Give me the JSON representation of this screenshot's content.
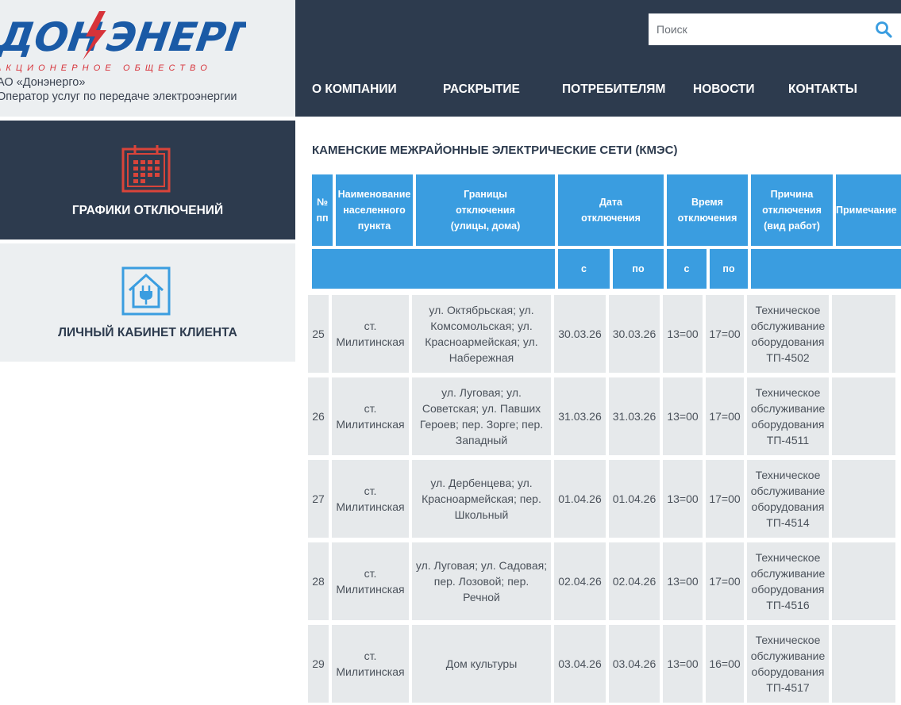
{
  "logo": {
    "wordmark": "ДОН ЭНЕРГО",
    "subtitle": "АКЦИОНЕРНОЕ ОБЩЕСТВО",
    "company": "АО «Донэнерго»",
    "tagline": "Оператор услуг по передаче электроэнергии"
  },
  "search": {
    "placeholder": "Поиск"
  },
  "nav": {
    "items": [
      {
        "label": "О КОМПАНИИ"
      },
      {
        "label": "РАСКРЫТИЕ"
      },
      {
        "label": "ПОТРЕБИТЕЛЯМ"
      },
      {
        "label": "НОВОСТИ"
      },
      {
        "label": "КОНТАКТЫ"
      }
    ]
  },
  "sidebar": {
    "outages": {
      "label": "ГРАФИКИ ОТКЛЮЧЕНИЙ",
      "icon": "calendar-icon",
      "color": "#d9443a"
    },
    "cabinet": {
      "label": "ЛИЧНЫЙ КАБИНЕТ КЛИЕНТА",
      "icon": "house-plug-icon",
      "color": "#3a9de0"
    }
  },
  "main": {
    "title": "КАМЕНСКИЕ МЕЖРАЙОННЫЕ ЭЛЕКТРИЧЕСКИЕ СЕТИ (КМЭС)"
  },
  "table": {
    "headers": {
      "num": "№\nпп",
      "place": "Наименование\nнаселенного\nпункта",
      "bounds": "Границы\nотключения\n(улицы, дома)",
      "date": "Дата\nотключения",
      "time": "Время\nотключения",
      "reason": "Причина\nотключения\n(вид работ)",
      "note": "Примечание",
      "date_from": "с",
      "date_to": "по",
      "time_from": "с",
      "time_to": "по"
    },
    "rows": [
      {
        "num": "25",
        "place": "ст. Милитинская",
        "bounds": "ул. Октябрьская; ул. Комсомольская; ул. Красноармейская; ул. Набережная",
        "date_from": "30.03.26",
        "date_to": "30.03.26",
        "time_from": "13=00",
        "time_to": "17=00",
        "reason": "Техническое обслуживание оборудования ТП-4502",
        "note": ""
      },
      {
        "num": "26",
        "place": "ст. Милитинская",
        "bounds": "ул. Луговая; ул. Советская; ул. Павших Героев; пер. Зорге; пер. Западный",
        "date_from": "31.03.26",
        "date_to": "31.03.26",
        "time_from": "13=00",
        "time_to": "17=00",
        "reason": "Техническое обслуживание оборудования ТП-4511",
        "note": ""
      },
      {
        "num": "27",
        "place": "ст. Милитинская",
        "bounds": "ул. Дербенцева; ул. Красноармейская; пер. Школьный",
        "date_from": "01.04.26",
        "date_to": "01.04.26",
        "time_from": "13=00",
        "time_to": "17=00",
        "reason": "Техническое обслуживание оборудования ТП-4514",
        "note": ""
      },
      {
        "num": "28",
        "place": "ст. Милитинская",
        "bounds": "ул. Луговая; ул. Садовая; пер. Лозовой; пер. Речной",
        "date_from": "02.04.26",
        "date_to": "02.04.26",
        "time_from": "13=00",
        "time_to": "17=00",
        "reason": "Техническое обслуживание оборудования ТП-4516",
        "note": ""
      },
      {
        "num": "29",
        "place": "ст. Милитинская",
        "bounds": "Дом культуры",
        "date_from": "03.04.26",
        "date_to": "03.04.26",
        "time_from": "13=00",
        "time_to": "16=00",
        "reason": "Техническое обслуживание оборудования ТП-4517",
        "note": ""
      }
    ]
  }
}
